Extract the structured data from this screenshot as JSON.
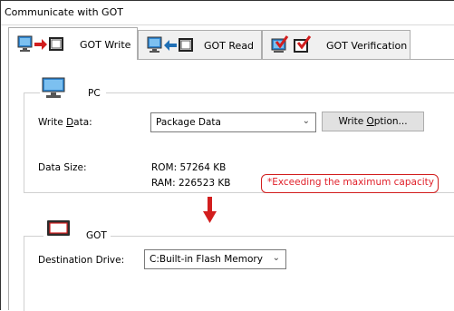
{
  "window": {
    "title": "Communicate with GOT"
  },
  "tabs": [
    {
      "label": "GOT Write",
      "active": true,
      "icon": "pc-to-got-icon"
    },
    {
      "label": "GOT Read",
      "active": false,
      "icon": "got-to-pc-icon"
    },
    {
      "label": "GOT Verification",
      "active": false,
      "icon": "verify-icon"
    }
  ],
  "pc_section": {
    "title": "PC",
    "write_data_label_pre": "Write ",
    "write_data_label_acc": "D",
    "write_data_label_post": "ata:",
    "write_data_value": "Package Data",
    "write_option_pre": "Write ",
    "write_option_acc": "O",
    "write_option_post": "ption...",
    "data_size_label": "Data Size:",
    "rom": "ROM: 57264 KB",
    "ram": "RAM: 226523 KB",
    "warning": "*Exceeding the maximum capacity"
  },
  "got_section": {
    "title": "GOT",
    "destination_label": "Destination Drive:",
    "destination_value": "C:Built-in Flash Memory"
  },
  "colors": {
    "warning_red": "#e0202a",
    "arrow_red": "#d21e1e",
    "icon_blue": "#1f6fb5"
  }
}
